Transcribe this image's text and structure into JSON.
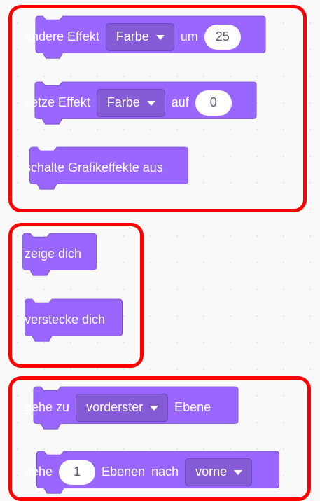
{
  "colors": {
    "block_fill": "#9966ff",
    "block_border": "#774dcb",
    "dropdown_fill": "#855cd6",
    "highlight": "#ff0000",
    "number_text": "#575e75"
  },
  "groups": [
    {
      "name": "effects",
      "blocks": [
        {
          "label1": "ändere Effekt",
          "dropdown": "Farbe",
          "label2": "um",
          "number": "25"
        },
        {
          "label1": "setze Effekt",
          "dropdown": "Farbe",
          "label2": "auf",
          "number": "0"
        },
        {
          "label1": "schalte Grafikeffekte aus"
        }
      ]
    },
    {
      "name": "visibility",
      "blocks": [
        {
          "label1": "zeige dich"
        },
        {
          "label1": "verstecke dich"
        }
      ]
    },
    {
      "name": "layers",
      "blocks": [
        {
          "label1": "gehe zu",
          "dropdown": "vorderster",
          "label2": "Ebene"
        },
        {
          "label1": "gehe",
          "number": "1",
          "label2": "Ebenen",
          "label3": "nach",
          "dropdown": "vorne"
        }
      ]
    }
  ]
}
